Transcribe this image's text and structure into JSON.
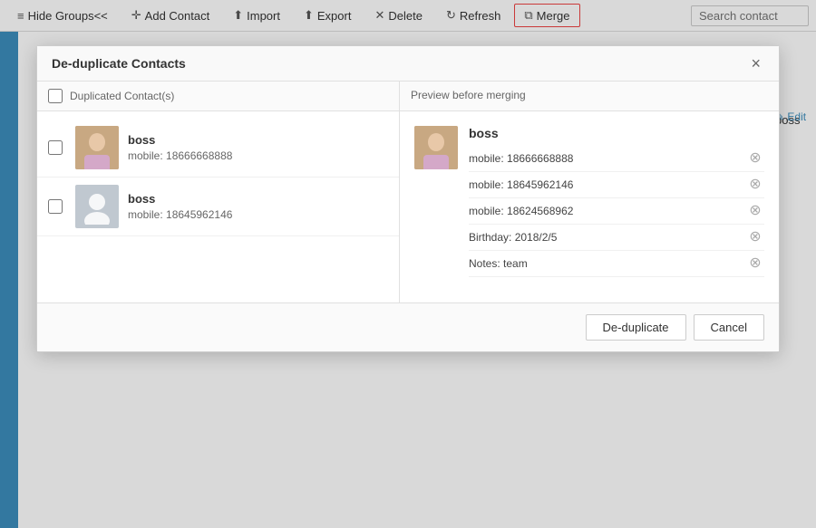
{
  "toolbar": {
    "hide_groups_label": "Hide Groups<<",
    "add_contact_label": "Add Contact",
    "import_label": "Import",
    "export_label": "Export",
    "delete_label": "Delete",
    "refresh_label": "Refresh",
    "merge_label": "Merge",
    "search_placeholder": "Search contact"
  },
  "modal": {
    "title": "De-duplicate Contacts",
    "col_header_left": "Duplicated Contact(s)",
    "col_header_right": "Preview before merging",
    "close_icon": "×",
    "contacts": [
      {
        "id": "c1",
        "name": "boss",
        "detail": "mobile: 18666668888",
        "has_photo": true
      },
      {
        "id": "c2",
        "name": "boss",
        "detail": "mobile: 18645962146",
        "has_photo": false
      }
    ],
    "preview": {
      "name": "boss",
      "fields": [
        {
          "label": "mobile: 18666668888"
        },
        {
          "label": "mobile: 18645962146"
        },
        {
          "label": "mobile: 18624568962"
        },
        {
          "label": "Birthday: 2018/2/5"
        },
        {
          "label": "Notes: team"
        }
      ]
    },
    "deduplicate_label": "De-duplicate",
    "cancel_label": "Cancel"
  },
  "background": {
    "boss_label": "boss",
    "edit_label": "✎ Edit"
  }
}
